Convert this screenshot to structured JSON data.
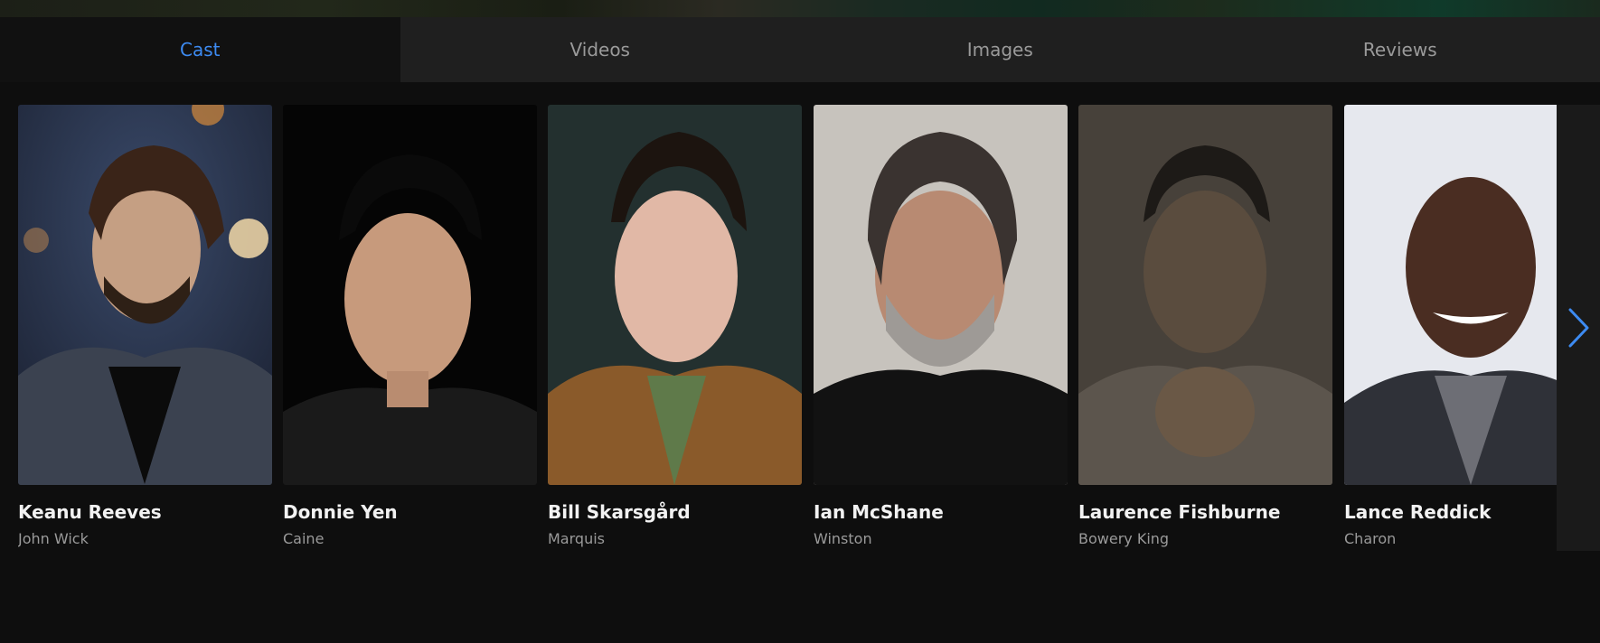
{
  "tabs": [
    {
      "label": "Cast",
      "active": true
    },
    {
      "label": "Videos",
      "active": false
    },
    {
      "label": "Images",
      "active": false
    },
    {
      "label": "Reviews",
      "active": false
    }
  ],
  "cast": [
    {
      "name": "Keanu Reeves",
      "role": "John Wick"
    },
    {
      "name": "Donnie Yen",
      "role": "Caine"
    },
    {
      "name": "Bill Skarsgård",
      "role": "Marquis"
    },
    {
      "name": "Ian McShane",
      "role": "Winston"
    },
    {
      "name": "Laurence Fishburne",
      "role": "Bowery King"
    },
    {
      "name": "Lance Reddick",
      "role": "Charon"
    }
  ],
  "next_icon": "chevron-right-icon",
  "colors": {
    "accent": "#3d8bf2",
    "background": "#0e0e0e",
    "tab_bar": "#1f1f1f"
  }
}
